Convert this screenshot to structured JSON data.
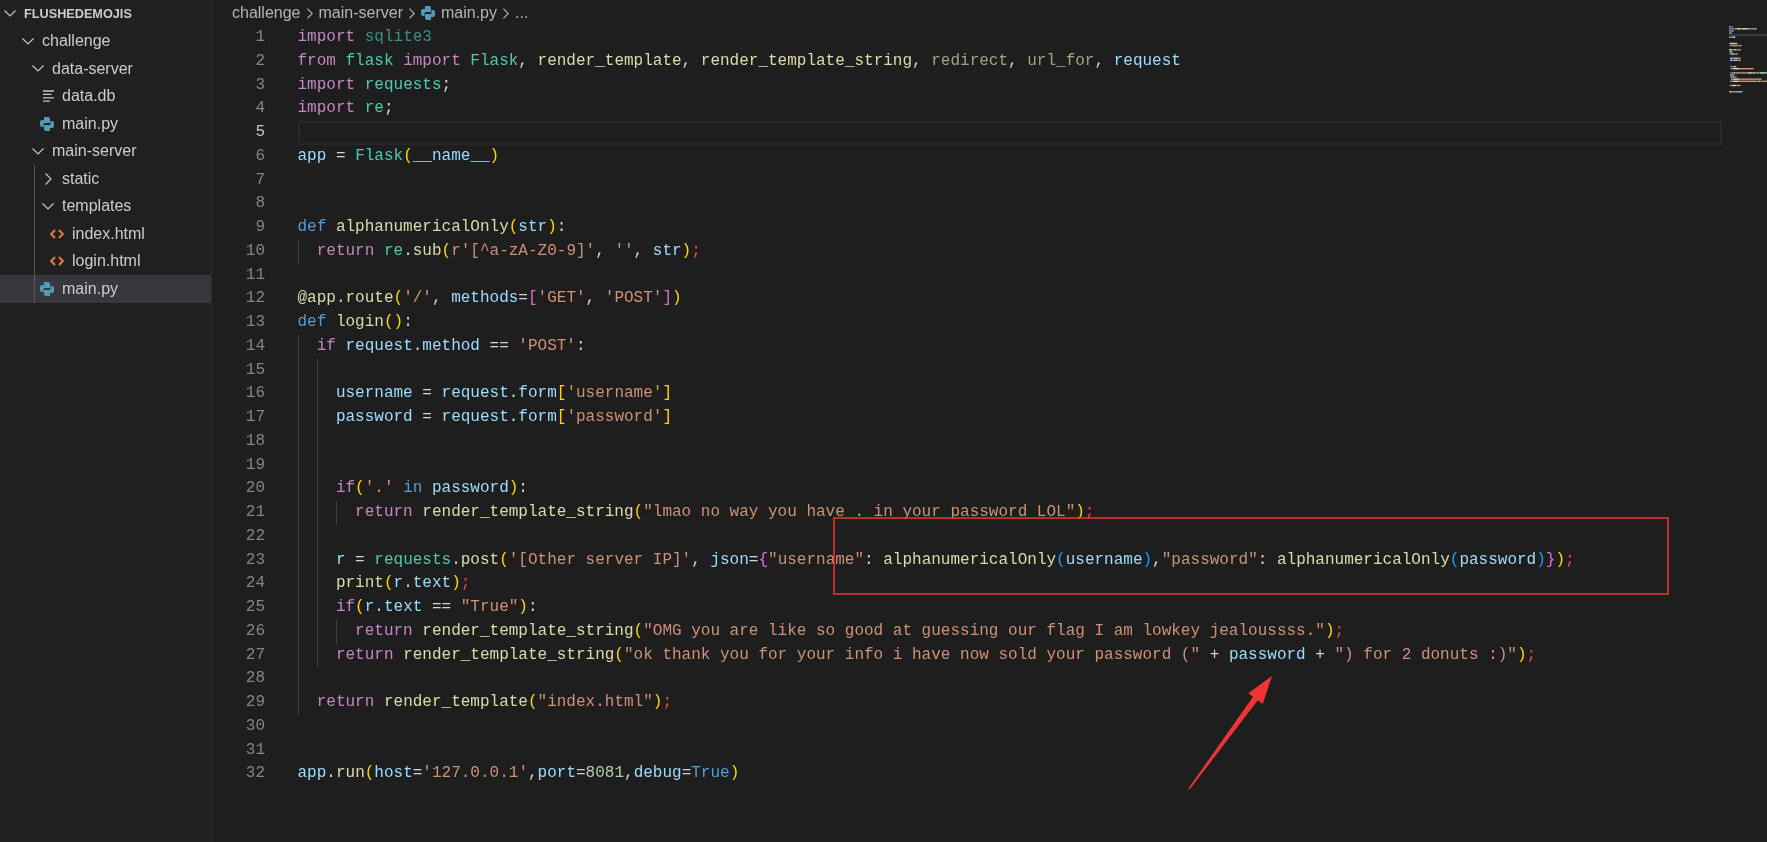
{
  "explorer": {
    "title": "FLUSHEDEMOJIS",
    "expanded": true,
    "items": [
      {
        "kind": "folder",
        "name": "challenge",
        "expanded": true,
        "selected": false,
        "children": [
          {
            "kind": "folder",
            "name": "data-server",
            "expanded": true,
            "selected": false,
            "children": [
              {
                "kind": "text",
                "name": "data.db",
                "selected": false
              },
              {
                "kind": "python",
                "name": "main.py",
                "selected": false
              }
            ]
          },
          {
            "kind": "folder",
            "name": "main-server",
            "expanded": true,
            "selected": false,
            "children": [
              {
                "kind": "folder",
                "name": "static",
                "expanded": false,
                "selected": false
              },
              {
                "kind": "folder",
                "name": "templates",
                "expanded": true,
                "selected": false,
                "children": [
                  {
                    "kind": "html",
                    "name": "index.html",
                    "selected": false
                  },
                  {
                    "kind": "html",
                    "name": "login.html",
                    "selected": false
                  }
                ]
              },
              {
                "kind": "python",
                "name": "main.py",
                "selected": true
              }
            ]
          }
        ]
      }
    ]
  },
  "breadcrumb": [
    {
      "kind": "folder",
      "label": "challenge"
    },
    {
      "kind": "folder",
      "label": "main-server"
    },
    {
      "kind": "python",
      "label": "main.py"
    },
    {
      "kind": "more",
      "label": "..."
    }
  ],
  "editor": {
    "lines": [
      {
        "number": "1",
        "active": false,
        "tokens": [
          {
            "kind": "keyword",
            "text": "import "
          },
          {
            "kind": "module_unused",
            "text": "sqlite3"
          }
        ]
      },
      {
        "number": "2",
        "active": false,
        "tokens": [
          {
            "kind": "keyword",
            "text": "from "
          },
          {
            "kind": "module",
            "text": "flask "
          },
          {
            "kind": "keyword",
            "text": "import "
          },
          {
            "kind": "module",
            "text": "Flask"
          },
          {
            "kind": "plain",
            "text": ", "
          },
          {
            "kind": "function",
            "text": "render_template"
          },
          {
            "kind": "plain",
            "text": ", "
          },
          {
            "kind": "function",
            "text": "render_template_string"
          },
          {
            "kind": "plain",
            "text": ", "
          },
          {
            "kind": "function_unused",
            "text": "redirect"
          },
          {
            "kind": "plain",
            "text": ", "
          },
          {
            "kind": "function_unused",
            "text": "url_for"
          },
          {
            "kind": "plain",
            "text": ", "
          },
          {
            "kind": "variable",
            "text": "request"
          }
        ]
      },
      {
        "number": "3",
        "active": false,
        "tokens": [
          {
            "kind": "keyword",
            "text": "import "
          },
          {
            "kind": "module",
            "text": "requests"
          },
          {
            "kind": "plain",
            "text": ";"
          }
        ]
      },
      {
        "number": "4",
        "active": false,
        "tokens": [
          {
            "kind": "keyword",
            "text": "import "
          },
          {
            "kind": "module",
            "text": "re"
          },
          {
            "kind": "plain",
            "text": ";"
          }
        ]
      },
      {
        "number": "5",
        "active": true
      },
      {
        "number": "6",
        "active": false,
        "tokens": [
          {
            "kind": "variable",
            "text": "app"
          },
          {
            "kind": "plain",
            "text": " = "
          },
          {
            "kind": "module",
            "text": "Flask"
          },
          {
            "kind": "bracket1",
            "text": "("
          },
          {
            "kind": "variable",
            "text": "__name__"
          },
          {
            "kind": "bracket1",
            "text": ")"
          }
        ]
      },
      {
        "number": "7",
        "active": false
      },
      {
        "number": "8",
        "active": false
      },
      {
        "number": "9",
        "active": false,
        "tokens": [
          {
            "kind": "storage",
            "text": "def "
          },
          {
            "kind": "function",
            "text": "alphanumericalOnly"
          },
          {
            "kind": "bracket1",
            "text": "("
          },
          {
            "kind": "variable",
            "text": "str"
          },
          {
            "kind": "bracket1",
            "text": ")"
          },
          {
            "kind": "plain",
            "text": ":"
          }
        ]
      },
      {
        "number": "10",
        "active": false,
        "tokens": [
          {
            "kind": "keyword",
            "text": "  return "
          },
          {
            "kind": "module",
            "text": "re"
          },
          {
            "kind": "plain",
            "text": "."
          },
          {
            "kind": "function",
            "text": "sub"
          },
          {
            "kind": "bracket1",
            "text": "("
          },
          {
            "kind": "string",
            "text": "r'[^a-zA-Z0-9]'"
          },
          {
            "kind": "plain",
            "text": ", "
          },
          {
            "kind": "string",
            "text": "''"
          },
          {
            "kind": "plain",
            "text": ", "
          },
          {
            "kind": "variable",
            "text": "str"
          },
          {
            "kind": "bracket1",
            "text": ")"
          },
          {
            "kind": "error",
            "text": ";"
          }
        ]
      },
      {
        "number": "11",
        "active": false
      },
      {
        "number": "12",
        "active": false,
        "tokens": [
          {
            "kind": "function",
            "text": "@app.route"
          },
          {
            "kind": "bracket1",
            "text": "("
          },
          {
            "kind": "string",
            "text": "'/'"
          },
          {
            "kind": "plain",
            "text": ", "
          },
          {
            "kind": "variable",
            "text": "methods"
          },
          {
            "kind": "plain",
            "text": "="
          },
          {
            "kind": "bracket2",
            "text": "["
          },
          {
            "kind": "string",
            "text": "'GET'"
          },
          {
            "kind": "plain",
            "text": ", "
          },
          {
            "kind": "string",
            "text": "'POST'"
          },
          {
            "kind": "bracket2",
            "text": "]"
          },
          {
            "kind": "bracket1",
            "text": ")"
          }
        ]
      },
      {
        "number": "13",
        "active": false,
        "tokens": [
          {
            "kind": "storage",
            "text": "def "
          },
          {
            "kind": "function",
            "text": "login"
          },
          {
            "kind": "bracket1",
            "text": "()"
          },
          {
            "kind": "plain",
            "text": ":"
          }
        ]
      },
      {
        "number": "14",
        "active": false,
        "tokens": [
          {
            "kind": "keyword",
            "text": "  if "
          },
          {
            "kind": "variable",
            "text": "request"
          },
          {
            "kind": "plain",
            "text": "."
          },
          {
            "kind": "variable",
            "text": "method"
          },
          {
            "kind": "plain",
            "text": " == "
          },
          {
            "kind": "string",
            "text": "'POST'"
          },
          {
            "kind": "plain",
            "text": ":"
          }
        ]
      },
      {
        "number": "15",
        "active": false
      },
      {
        "number": "16",
        "active": false,
        "tokens": [
          {
            "kind": "variable",
            "text": "    username"
          },
          {
            "kind": "plain",
            "text": " = "
          },
          {
            "kind": "variable",
            "text": "request"
          },
          {
            "kind": "plain",
            "text": "."
          },
          {
            "kind": "variable",
            "text": "form"
          },
          {
            "kind": "bracket1",
            "text": "["
          },
          {
            "kind": "string",
            "text": "'username'"
          },
          {
            "kind": "bracket1",
            "text": "]"
          }
        ]
      },
      {
        "number": "17",
        "active": false,
        "tokens": [
          {
            "kind": "variable",
            "text": "    password"
          },
          {
            "kind": "plain",
            "text": " = "
          },
          {
            "kind": "variable",
            "text": "request"
          },
          {
            "kind": "plain",
            "text": "."
          },
          {
            "kind": "variable",
            "text": "form"
          },
          {
            "kind": "bracket1",
            "text": "["
          },
          {
            "kind": "string",
            "text": "'password'"
          },
          {
            "kind": "bracket1",
            "text": "]"
          }
        ]
      },
      {
        "number": "18",
        "active": false
      },
      {
        "number": "19",
        "active": false
      },
      {
        "number": "20",
        "active": false,
        "tokens": [
          {
            "kind": "keyword",
            "text": "    if"
          },
          {
            "kind": "bracket1",
            "text": "("
          },
          {
            "kind": "string",
            "text": "'.'"
          },
          {
            "kind": "storage",
            "text": " in "
          },
          {
            "kind": "variable",
            "text": "password"
          },
          {
            "kind": "bracket1",
            "text": ")"
          },
          {
            "kind": "plain",
            "text": ":"
          }
        ]
      },
      {
        "number": "21",
        "active": false,
        "tokens": [
          {
            "kind": "keyword",
            "text": "      return "
          },
          {
            "kind": "function",
            "text": "render_template_string"
          },
          {
            "kind": "bracket1",
            "text": "("
          },
          {
            "kind": "string",
            "text": "\"lmao no way you have . in your password LOL\""
          },
          {
            "kind": "bracket1",
            "text": ")"
          },
          {
            "kind": "error",
            "text": ";"
          }
        ]
      },
      {
        "number": "22",
        "active": false
      },
      {
        "number": "23",
        "active": false,
        "tokens": [
          {
            "kind": "variable",
            "text": "    r"
          },
          {
            "kind": "plain",
            "text": " = "
          },
          {
            "kind": "module",
            "text": "requests"
          },
          {
            "kind": "plain",
            "text": "."
          },
          {
            "kind": "function",
            "text": "post"
          },
          {
            "kind": "bracket1",
            "text": "("
          },
          {
            "kind": "string",
            "text": "'[Other server IP]'"
          },
          {
            "kind": "plain",
            "text": ", "
          },
          {
            "kind": "variable",
            "text": "json"
          },
          {
            "kind": "plain",
            "text": "="
          },
          {
            "kind": "bracket2",
            "text": "{"
          },
          {
            "kind": "string",
            "text": "\"username\""
          },
          {
            "kind": "plain",
            "text": ": "
          },
          {
            "kind": "function",
            "text": "alphanumericalOnly"
          },
          {
            "kind": "bracket3",
            "text": "("
          },
          {
            "kind": "variable",
            "text": "username"
          },
          {
            "kind": "bracket3",
            "text": ")"
          },
          {
            "kind": "plain",
            "text": ","
          },
          {
            "kind": "string",
            "text": "\"password\""
          },
          {
            "kind": "plain",
            "text": ": "
          },
          {
            "kind": "function",
            "text": "alphanumericalOnly"
          },
          {
            "kind": "bracket3",
            "text": "("
          },
          {
            "kind": "variable",
            "text": "password"
          },
          {
            "kind": "bracket3",
            "text": ")"
          },
          {
            "kind": "bracket2",
            "text": "}"
          },
          {
            "kind": "bracket1",
            "text": ")"
          },
          {
            "kind": "error",
            "text": ";"
          }
        ]
      },
      {
        "number": "24",
        "active": false,
        "tokens": [
          {
            "kind": "function",
            "text": "    print"
          },
          {
            "kind": "bracket1",
            "text": "("
          },
          {
            "kind": "variable",
            "text": "r"
          },
          {
            "kind": "plain",
            "text": "."
          },
          {
            "kind": "variable",
            "text": "text"
          },
          {
            "kind": "bracket1",
            "text": ")"
          },
          {
            "kind": "error",
            "text": ";"
          }
        ]
      },
      {
        "number": "25",
        "active": false,
        "tokens": [
          {
            "kind": "keyword",
            "text": "    if"
          },
          {
            "kind": "bracket1",
            "text": "("
          },
          {
            "kind": "variable",
            "text": "r"
          },
          {
            "kind": "plain",
            "text": "."
          },
          {
            "kind": "variable",
            "text": "text"
          },
          {
            "kind": "plain",
            "text": " == "
          },
          {
            "kind": "string",
            "text": "\"True\""
          },
          {
            "kind": "bracket1",
            "text": ")"
          },
          {
            "kind": "plain",
            "text": ":"
          }
        ]
      },
      {
        "number": "26",
        "active": false,
        "tokens": [
          {
            "kind": "keyword",
            "text": "      return "
          },
          {
            "kind": "function",
            "text": "render_template_string"
          },
          {
            "kind": "bracket1",
            "text": "("
          },
          {
            "kind": "string",
            "text": "\"OMG you are like so good at guessing our flag I am lowkey jealoussss.\""
          },
          {
            "kind": "bracket1",
            "text": ")"
          },
          {
            "kind": "error",
            "text": ";"
          }
        ]
      },
      {
        "number": "27",
        "active": false,
        "tokens": [
          {
            "kind": "keyword",
            "text": "    return "
          },
          {
            "kind": "function",
            "text": "render_template_string"
          },
          {
            "kind": "bracket1",
            "text": "("
          },
          {
            "kind": "string",
            "text": "\"ok thank you for your info i have now sold your password (\""
          },
          {
            "kind": "plain",
            "text": " + "
          },
          {
            "kind": "variable",
            "text": "password"
          },
          {
            "kind": "plain",
            "text": " + "
          },
          {
            "kind": "string",
            "text": "\") for 2 donuts :)\""
          },
          {
            "kind": "bracket1",
            "text": ")"
          },
          {
            "kind": "error",
            "text": ";"
          }
        ]
      },
      {
        "number": "28",
        "active": false
      },
      {
        "number": "29",
        "active": false,
        "tokens": [
          {
            "kind": "keyword",
            "text": "  return "
          },
          {
            "kind": "function",
            "text": "render_template"
          },
          {
            "kind": "bracket1",
            "text": "("
          },
          {
            "kind": "string",
            "text": "\"index.html\""
          },
          {
            "kind": "bracket1",
            "text": ")"
          },
          {
            "kind": "error",
            "text": ";"
          }
        ]
      },
      {
        "number": "30",
        "active": false
      },
      {
        "number": "31",
        "active": false
      },
      {
        "number": "32",
        "active": false,
        "tokens": [
          {
            "kind": "variable",
            "text": "app"
          },
          {
            "kind": "plain",
            "text": "."
          },
          {
            "kind": "function",
            "text": "run"
          },
          {
            "kind": "bracket1",
            "text": "("
          },
          {
            "kind": "variable",
            "text": "host"
          },
          {
            "kind": "plain",
            "text": "="
          },
          {
            "kind": "string",
            "text": "'127.0.0.1'"
          },
          {
            "kind": "plain",
            "text": ","
          },
          {
            "kind": "variable",
            "text": "port"
          },
          {
            "kind": "plain",
            "text": "="
          },
          {
            "kind": "number",
            "text": "8081"
          },
          {
            "kind": "plain",
            "text": ","
          },
          {
            "kind": "variable",
            "text": "debug"
          },
          {
            "kind": "plain",
            "text": "="
          },
          {
            "kind": "storage",
            "text": "True"
          },
          {
            "kind": "bracket1",
            "text": ")"
          }
        ]
      }
    ]
  },
  "annotations": [
    {
      "kind": "frame"
    },
    {
      "kind": "arrow"
    }
  ]
}
